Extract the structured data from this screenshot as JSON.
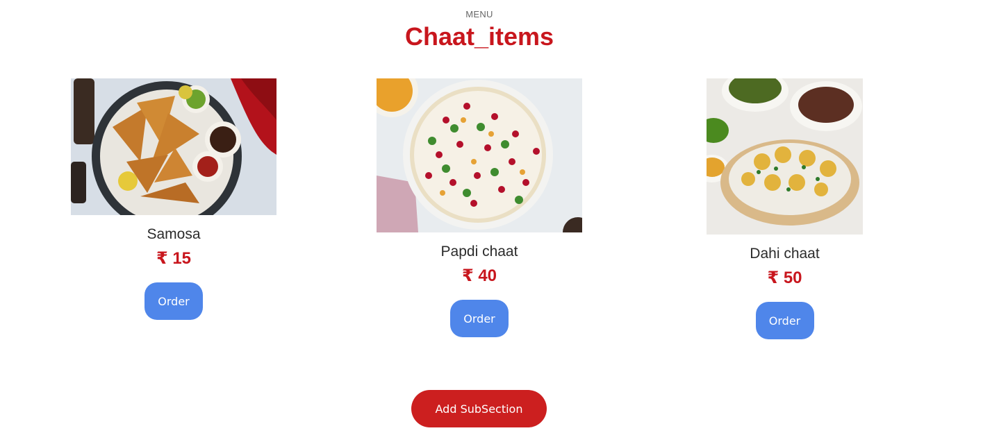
{
  "header": {
    "eyebrow": "MENU",
    "title": "Chaat_items"
  },
  "items": [
    {
      "name": "Samosa",
      "price": "₹ 15",
      "order_label": "Order",
      "image_subject": "samosa-plate"
    },
    {
      "name": "Papdi chaat",
      "price": "₹ 40",
      "order_label": "Order",
      "image_subject": "papdi-chaat-plate"
    },
    {
      "name": "Dahi chaat",
      "price": "₹ 50",
      "order_label": "Order",
      "image_subject": "dahi-chaat-bowl"
    }
  ],
  "footer": {
    "add_subsection_label": "Add SubSection"
  },
  "colors": {
    "accent_red": "#c8161d",
    "order_blue": "#4f86ea",
    "add_red": "#cc1f1f"
  }
}
